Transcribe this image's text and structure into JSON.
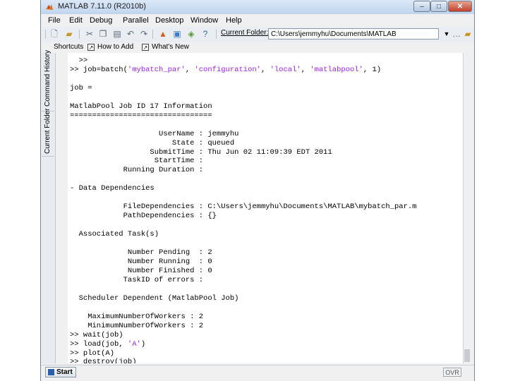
{
  "window": {
    "title": "MATLAB  7.11.0 (R2010b)",
    "controls": {
      "minimize": "–",
      "maximize": "□",
      "close": "✕"
    }
  },
  "menubar": {
    "items": [
      "File",
      "Edit",
      "Debug",
      "Parallel",
      "Desktop",
      "Window",
      "Help"
    ]
  },
  "toolbar": {
    "icons": [
      "new-file-icon",
      "open-folder-icon",
      "cut-icon",
      "copy-icon",
      "paste-icon",
      "undo-icon",
      "redo-icon",
      "simulink-icon",
      "guide-icon",
      "profiler-icon",
      "help-icon"
    ],
    "current_folder_label": "Current Folder:",
    "current_folder_value": "C:\\Users\\jemmyhu\\Documents\\MATLAB"
  },
  "shortcuts": {
    "label": "Shortcuts",
    "items": [
      "How to Add",
      "What's New"
    ]
  },
  "sidebar": {
    "tabs": [
      "Command History",
      "Current Folder"
    ]
  },
  "command_window": {
    "lines": [
      "  >>",
      ">> job=batch('mybatch_par', 'configuration', 'local', 'matlabpool', 1)",
      "",
      "job =",
      "",
      "MatlabPool Job ID 17 Information",
      "================================",
      "",
      "                    UserName : jemmyhu",
      "                       State : queued",
      "                  SubmitTime : Thu Jun 02 11:09:39 EDT 2011",
      "                   StartTime :",
      "            Running Duration :",
      "",
      "- Data Dependencies",
      "",
      "            FileDependencies : C:\\Users\\jemmyhu\\Documents\\MATLAB\\mybatch_par.m",
      "            PathDependencies : {}",
      "",
      "  Associated Task(s)",
      "",
      "             Number Pending  : 2",
      "             Number Running  : 0",
      "             Number Finished : 0",
      "            TaskID of errors :",
      "",
      "  Scheduler Dependent (MatlabPool Job)",
      "",
      "    MaximumNumberOfWorkers : 2",
      "    MinimumNumberOfWorkers : 2",
      ">> wait(job)",
      ">> load(job, 'A')",
      ">> plot(A)",
      ">> destroy(job)",
      ">>"
    ]
  },
  "statusbar": {
    "start_label": "Start",
    "mode": "OVR"
  }
}
